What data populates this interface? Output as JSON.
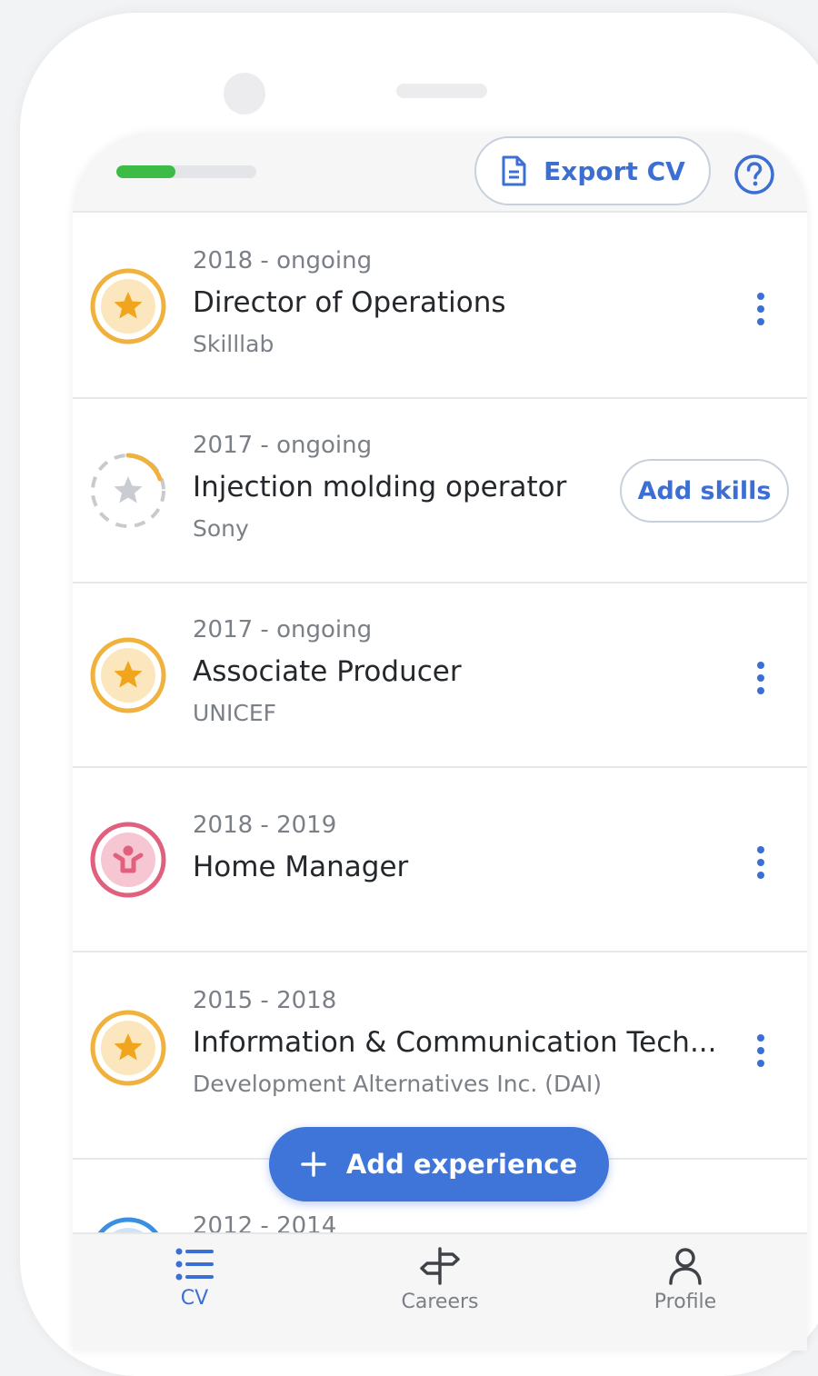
{
  "topbar": {
    "profile_progress": 0.42,
    "export_label": "Export CV",
    "help_icon": "question-circle-icon"
  },
  "experiences": [
    {
      "dates": "2018 - ongoing",
      "title": "Director of Operations",
      "company": "Skilllab",
      "badge": "star-badge-icon",
      "action": "more"
    },
    {
      "dates": "2017 - ongoing",
      "title": "Injection molding operator",
      "company": "Sony",
      "badge": "star-badge-incomplete-icon",
      "action": "add-skills"
    },
    {
      "dates": "2017 - ongoing",
      "title": "Associate Producer",
      "company": "UNICEF",
      "badge": "star-badge-icon",
      "action": "more"
    },
    {
      "dates": "2018 - 2019",
      "title": "Home Manager",
      "company": "",
      "badge": "person-badge-icon",
      "action": "more"
    },
    {
      "dates": "2015 - 2018",
      "title": "Information & Communication Tech...",
      "company": "Development Alternatives Inc. (DAI)",
      "badge": "star-badge-icon",
      "action": "more"
    },
    {
      "dates": "2012 - 2014",
      "title": "",
      "company": "",
      "badge": "blue-badge-icon",
      "action": ""
    }
  ],
  "add_skills_label": "Add skills",
  "fab": {
    "label": "Add experience",
    "icon": "plus-icon"
  },
  "bottom_nav": [
    {
      "label": "CV",
      "icon": "list-icon",
      "active": true
    },
    {
      "label": "Careers",
      "icon": "signpost-icon",
      "active": false
    },
    {
      "label": "Profile",
      "icon": "person-icon",
      "active": false
    }
  ],
  "colors": {
    "accent": "#3b6fd4",
    "progress": "#3dbb47",
    "gold_badge": "#f0b23c",
    "pink_badge": "#e0607e"
  }
}
